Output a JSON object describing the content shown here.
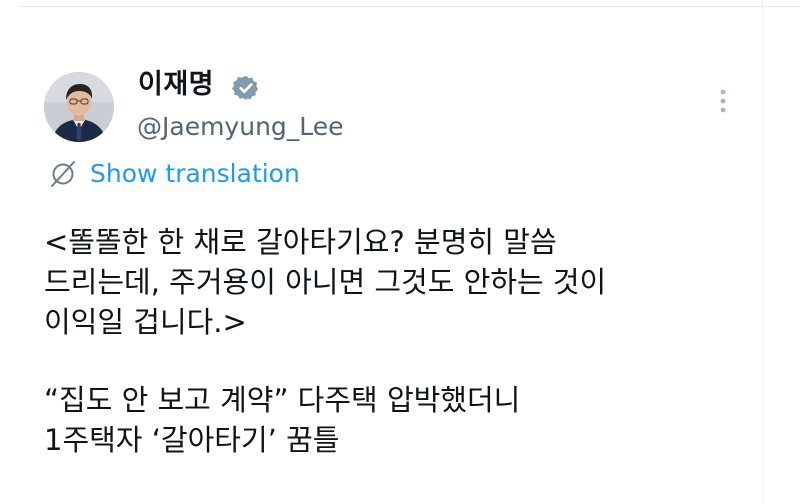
{
  "author": {
    "display_name": "이재명",
    "handle": "@Jaemyung_Lee",
    "avatar_icon": "portrait-photo",
    "verified_icon": "verified-badge-icon"
  },
  "actions": {
    "more_icon": "more-vertical-icon",
    "translate_icon": "globe-icon",
    "translate_label": "Show translation"
  },
  "tweet": {
    "lines": [
      "<똘똘한 한 채로 갈아타기요? 분명히 말씀",
      "드리는데, 주거용이 아니면 그것도 안하는 것이",
      "이익일 겁니다.>",
      "",
      "“집도 안 보고 계약” 다주택 압박했더니",
      "1주택자 ‘갈아타기’ 꿈틀"
    ]
  },
  "colors": {
    "text": "#0f1419",
    "secondary": "#536471",
    "link": "#1d9bf0",
    "verified": "#829aab"
  }
}
